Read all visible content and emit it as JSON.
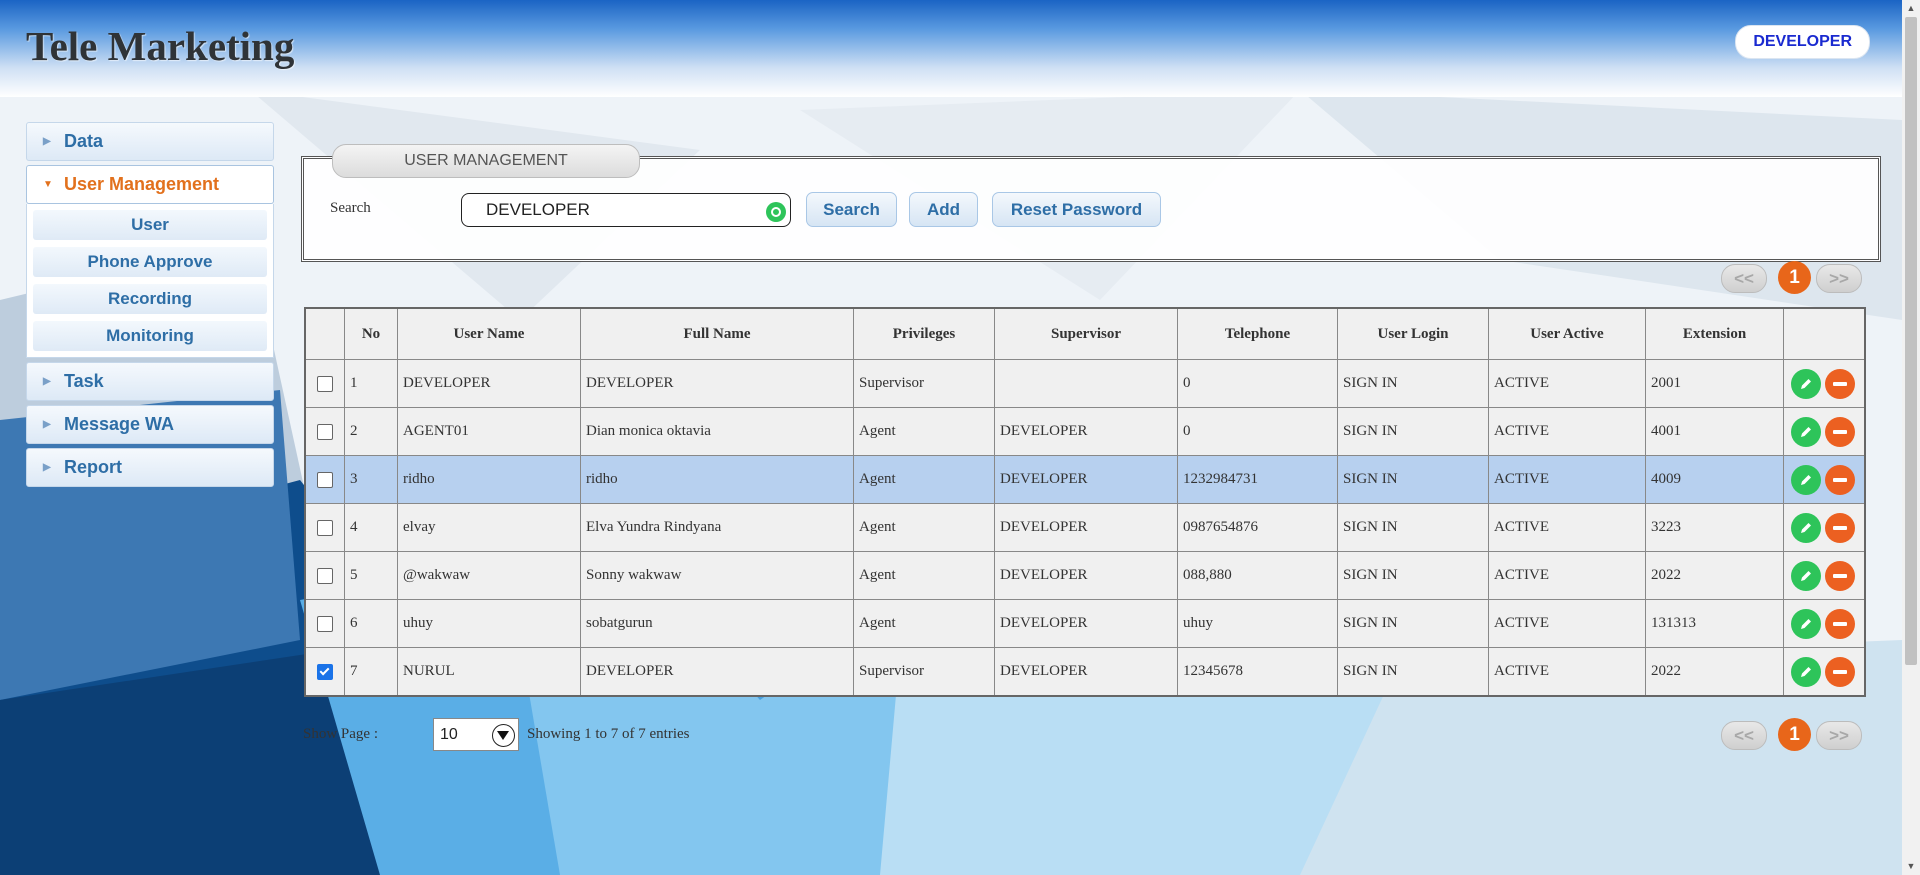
{
  "app": {
    "title": "Tele Marketing",
    "user": "DEVELOPER"
  },
  "sidebar": {
    "items": [
      {
        "label": "Data",
        "active": false
      },
      {
        "label": "User Management",
        "active": true,
        "children": [
          "User",
          "Phone Approve",
          "Recording",
          "Monitoring"
        ]
      },
      {
        "label": "Task",
        "active": false
      },
      {
        "label": "Message WA",
        "active": false
      },
      {
        "label": "Report",
        "active": false
      }
    ]
  },
  "panel": {
    "title": "USER MANAGEMENT",
    "search_label": "Search",
    "search_value": "DEVELOPER",
    "buttons": {
      "search": "Search",
      "add": "Add",
      "reset": "Reset Password"
    }
  },
  "pagination": {
    "prev": "<<",
    "current": "1",
    "next": ">>"
  },
  "table": {
    "headers": [
      "No",
      "User Name",
      "Full Name",
      "Privileges",
      "Supervisor",
      "Telephone",
      "User Login",
      "User Active",
      "Extension"
    ],
    "rows": [
      {
        "checked": false,
        "selected": false,
        "cells": [
          "1",
          "DEVELOPER",
          "DEVELOPER",
          "Supervisor",
          "",
          "0",
          "SIGN IN",
          "ACTIVE",
          "2001"
        ]
      },
      {
        "checked": false,
        "selected": false,
        "cells": [
          "2",
          "AGENT01",
          "Dian monica oktavia",
          "Agent",
          "DEVELOPER",
          "0",
          "SIGN IN",
          "ACTIVE",
          "4001"
        ]
      },
      {
        "checked": false,
        "selected": true,
        "cells": [
          "3",
          "ridho",
          "ridho",
          "Agent",
          "DEVELOPER",
          "1232984731",
          "SIGN IN",
          "ACTIVE",
          "4009"
        ]
      },
      {
        "checked": false,
        "selected": false,
        "cells": [
          "4",
          "elvay",
          "Elva Yundra Rindyana",
          "Agent",
          "DEVELOPER",
          "0987654876",
          "SIGN IN",
          "ACTIVE",
          "3223"
        ]
      },
      {
        "checked": false,
        "selected": false,
        "cells": [
          "5",
          "@wakwaw",
          "Sonny wakwaw",
          "Agent",
          "DEVELOPER",
          "088,880",
          "SIGN IN",
          "ACTIVE",
          "2022"
        ]
      },
      {
        "checked": false,
        "selected": false,
        "cells": [
          "6",
          "uhuy",
          "sobatgurun",
          "Agent",
          "DEVELOPER",
          "uhuy",
          "SIGN IN",
          "ACTIVE",
          "131313"
        ]
      },
      {
        "checked": true,
        "selected": false,
        "cells": [
          "7",
          "NURUL",
          "DEVELOPER",
          "Supervisor",
          "DEVELOPER",
          "12345678",
          "SIGN IN",
          "ACTIVE",
          "2022"
        ]
      }
    ]
  },
  "footer": {
    "show_page_label": "Show Page :",
    "page_size": "10",
    "showing": "Showing 1 to 7 of 7 entries"
  },
  "colors": {
    "accent": "#e8661a",
    "edit": "#2ec45a",
    "delete": "#ec6021",
    "link": "#2e6ea6",
    "selected_row": "#b7d0ef"
  },
  "icons": {
    "clear": "clear-circle-icon",
    "edit": "pencil-icon",
    "delete": "minus-icon",
    "collapsed": "triangle-right-icon",
    "expanded": "triangle-down-icon"
  }
}
